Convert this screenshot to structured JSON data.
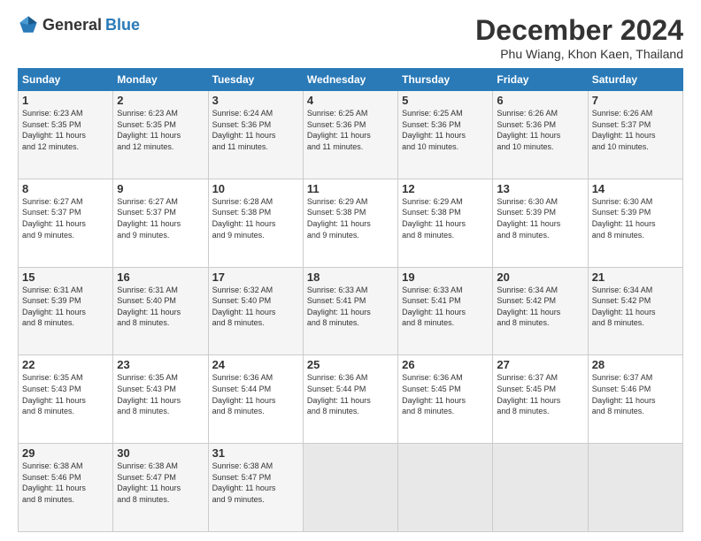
{
  "logo": {
    "general": "General",
    "blue": "Blue"
  },
  "title": "December 2024",
  "location": "Phu Wiang, Khon Kaen, Thailand",
  "days_of_week": [
    "Sunday",
    "Monday",
    "Tuesday",
    "Wednesday",
    "Thursday",
    "Friday",
    "Saturday"
  ],
  "weeks": [
    [
      {
        "day": "1",
        "sunrise": "6:23 AM",
        "sunset": "5:35 PM",
        "daylight": "11 hours and 12 minutes."
      },
      {
        "day": "2",
        "sunrise": "6:23 AM",
        "sunset": "5:35 PM",
        "daylight": "11 hours and 12 minutes."
      },
      {
        "day": "3",
        "sunrise": "6:24 AM",
        "sunset": "5:36 PM",
        "daylight": "11 hours and 11 minutes."
      },
      {
        "day": "4",
        "sunrise": "6:25 AM",
        "sunset": "5:36 PM",
        "daylight": "11 hours and 11 minutes."
      },
      {
        "day": "5",
        "sunrise": "6:25 AM",
        "sunset": "5:36 PM",
        "daylight": "11 hours and 10 minutes."
      },
      {
        "day": "6",
        "sunrise": "6:26 AM",
        "sunset": "5:36 PM",
        "daylight": "11 hours and 10 minutes."
      },
      {
        "day": "7",
        "sunrise": "6:26 AM",
        "sunset": "5:37 PM",
        "daylight": "11 hours and 10 minutes."
      }
    ],
    [
      {
        "day": "8",
        "sunrise": "6:27 AM",
        "sunset": "5:37 PM",
        "daylight": "11 hours and 9 minutes."
      },
      {
        "day": "9",
        "sunrise": "6:27 AM",
        "sunset": "5:37 PM",
        "daylight": "11 hours and 9 minutes."
      },
      {
        "day": "10",
        "sunrise": "6:28 AM",
        "sunset": "5:38 PM",
        "daylight": "11 hours and 9 minutes."
      },
      {
        "day": "11",
        "sunrise": "6:29 AM",
        "sunset": "5:38 PM",
        "daylight": "11 hours and 9 minutes."
      },
      {
        "day": "12",
        "sunrise": "6:29 AM",
        "sunset": "5:38 PM",
        "daylight": "11 hours and 8 minutes."
      },
      {
        "day": "13",
        "sunrise": "6:30 AM",
        "sunset": "5:39 PM",
        "daylight": "11 hours and 8 minutes."
      },
      {
        "day": "14",
        "sunrise": "6:30 AM",
        "sunset": "5:39 PM",
        "daylight": "11 hours and 8 minutes."
      }
    ],
    [
      {
        "day": "15",
        "sunrise": "6:31 AM",
        "sunset": "5:39 PM",
        "daylight": "11 hours and 8 minutes."
      },
      {
        "day": "16",
        "sunrise": "6:31 AM",
        "sunset": "5:40 PM",
        "daylight": "11 hours and 8 minutes."
      },
      {
        "day": "17",
        "sunrise": "6:32 AM",
        "sunset": "5:40 PM",
        "daylight": "11 hours and 8 minutes."
      },
      {
        "day": "18",
        "sunrise": "6:33 AM",
        "sunset": "5:41 PM",
        "daylight": "11 hours and 8 minutes."
      },
      {
        "day": "19",
        "sunrise": "6:33 AM",
        "sunset": "5:41 PM",
        "daylight": "11 hours and 8 minutes."
      },
      {
        "day": "20",
        "sunrise": "6:34 AM",
        "sunset": "5:42 PM",
        "daylight": "11 hours and 8 minutes."
      },
      {
        "day": "21",
        "sunrise": "6:34 AM",
        "sunset": "5:42 PM",
        "daylight": "11 hours and 8 minutes."
      }
    ],
    [
      {
        "day": "22",
        "sunrise": "6:35 AM",
        "sunset": "5:43 PM",
        "daylight": "11 hours and 8 minutes."
      },
      {
        "day": "23",
        "sunrise": "6:35 AM",
        "sunset": "5:43 PM",
        "daylight": "11 hours and 8 minutes."
      },
      {
        "day": "24",
        "sunrise": "6:36 AM",
        "sunset": "5:44 PM",
        "daylight": "11 hours and 8 minutes."
      },
      {
        "day": "25",
        "sunrise": "6:36 AM",
        "sunset": "5:44 PM",
        "daylight": "11 hours and 8 minutes."
      },
      {
        "day": "26",
        "sunrise": "6:36 AM",
        "sunset": "5:45 PM",
        "daylight": "11 hours and 8 minutes."
      },
      {
        "day": "27",
        "sunrise": "6:37 AM",
        "sunset": "5:45 PM",
        "daylight": "11 hours and 8 minutes."
      },
      {
        "day": "28",
        "sunrise": "6:37 AM",
        "sunset": "5:46 PM",
        "daylight": "11 hours and 8 minutes."
      }
    ],
    [
      {
        "day": "29",
        "sunrise": "6:38 AM",
        "sunset": "5:46 PM",
        "daylight": "11 hours and 8 minutes."
      },
      {
        "day": "30",
        "sunrise": "6:38 AM",
        "sunset": "5:47 PM",
        "daylight": "11 hours and 8 minutes."
      },
      {
        "day": "31",
        "sunrise": "6:38 AM",
        "sunset": "5:47 PM",
        "daylight": "11 hours and 9 minutes."
      },
      null,
      null,
      null,
      null
    ]
  ]
}
